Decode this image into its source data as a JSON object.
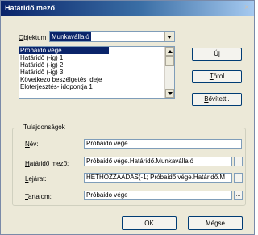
{
  "window": {
    "title": "Határidő mező",
    "close_glyph": "×"
  },
  "objektum": {
    "label_underlined": "O",
    "label_rest": "bjektum",
    "selected_value": "Munkavállaló",
    "dropdown_icon": "chevron-down-icon"
  },
  "list": {
    "items": [
      {
        "label": "Próbaido vége"
      },
      {
        "label": "Határidő (-ig) 1"
      },
      {
        "label": "Határidő (-ig) 2"
      },
      {
        "label": "Határidő (-ig) 3"
      },
      {
        "label": "Következo beszélgetés ideje"
      },
      {
        "label": "Eloterjesztés- idopontja 1"
      }
    ],
    "selected_index": 0
  },
  "buttons": {
    "new_underlined": "Ú",
    "new_rest": "j",
    "delete_underlined": "T",
    "delete_rest": "örol",
    "expand_underlined": "B",
    "expand_rest": "ővített..",
    "ok": "OK",
    "cancel": "Mégse"
  },
  "properties": {
    "group_title": "Tulajdonságok",
    "name_label_underlined": "N",
    "name_label_rest": "év:",
    "name_value": "Próbaido vége",
    "deadline_label_underlined": "H",
    "deadline_label_rest": "atáridő mező:",
    "deadline_value": "Próbaidő vége.Határidő.Munkavállaló",
    "expiry_label_underlined": "L",
    "expiry_label_rest": "ejárat:",
    "expiry_value": "HÉTHOZZÁADÁS(-1; Próbaidő vége.Határidő.M",
    "content_label_underlined": "T",
    "content_label_rest": "artalom:",
    "content_value": "Próbaido vége",
    "ellipsis": "..."
  },
  "colors": {
    "selection": "#0a246a",
    "dialog_bg": "#ece9d8",
    "title_gradient_start": "#0a246a",
    "title_gradient_end": "#a6caf0"
  }
}
